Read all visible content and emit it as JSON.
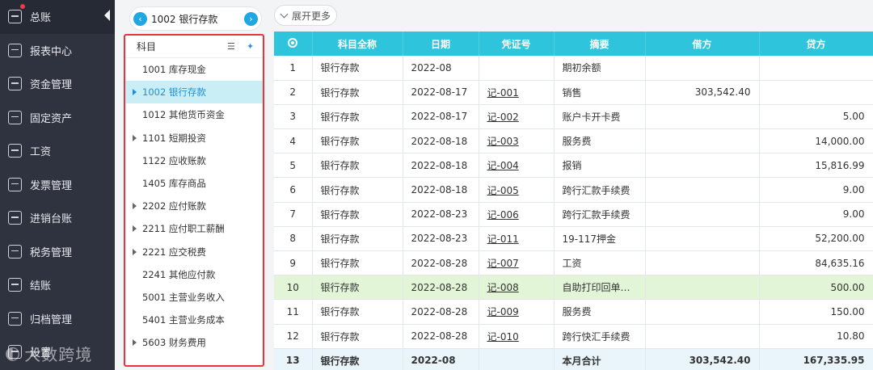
{
  "nav": {
    "items": [
      {
        "label": "总账",
        "icon": "ledger-icon"
      },
      {
        "label": "报表中心",
        "icon": "report-chart-icon"
      },
      {
        "label": "资金管理",
        "icon": "money-bag-icon"
      },
      {
        "label": "固定资产",
        "icon": "building-icon"
      },
      {
        "label": "工资",
        "icon": "salary-icon"
      },
      {
        "label": "发票管理",
        "icon": "invoice-icon"
      },
      {
        "label": "进销台账",
        "icon": "inventory-ledger-icon"
      },
      {
        "label": "税务管理",
        "icon": "tax-icon"
      },
      {
        "label": "结账",
        "icon": "checkout-icon"
      },
      {
        "label": "归档管理",
        "icon": "archive-icon"
      },
      {
        "label": "设置",
        "icon": "settings-icon"
      }
    ],
    "watermark": "大数跨境"
  },
  "account_selector": {
    "prev_icon": "chevron-left-icon",
    "next_icon": "chevron-right-icon",
    "current": "1002 银行存款"
  },
  "subject_tree": {
    "header": "科目",
    "items": [
      {
        "label": "1001 库存现金",
        "expandable": false,
        "selected": false
      },
      {
        "label": "1002 银行存款",
        "expandable": true,
        "selected": true
      },
      {
        "label": "1012 其他货币资金",
        "expandable": false,
        "selected": false
      },
      {
        "label": "1101 短期投资",
        "expandable": true,
        "selected": false
      },
      {
        "label": "1122 应收账款",
        "expandable": false,
        "selected": false
      },
      {
        "label": "1405 库存商品",
        "expandable": false,
        "selected": false
      },
      {
        "label": "2202 应付账款",
        "expandable": true,
        "selected": false
      },
      {
        "label": "2211 应付职工薪酬",
        "expandable": true,
        "selected": false
      },
      {
        "label": "2221 应交税费",
        "expandable": true,
        "selected": false
      },
      {
        "label": "2241 其他应付款",
        "expandable": false,
        "selected": false
      },
      {
        "label": "5001 主营业务收入",
        "expandable": false,
        "selected": false
      },
      {
        "label": "5401 主营业务成本",
        "expandable": false,
        "selected": false
      },
      {
        "label": "5603 财务费用",
        "expandable": true,
        "selected": false
      }
    ]
  },
  "toolbar": {
    "expand_label": "展开更多"
  },
  "ledger": {
    "columns": [
      "科目全称",
      "日期",
      "凭证号",
      "摘要",
      "借方",
      "贷方"
    ],
    "rows": [
      {
        "idx": "1",
        "account": "银行存款",
        "date": "2022-08",
        "voucher": "",
        "summary": "期初余额",
        "debit": "",
        "credit": ""
      },
      {
        "idx": "2",
        "account": "银行存款",
        "date": "2022-08-17",
        "voucher": "记-001",
        "summary": "销售",
        "debit": "303,542.40",
        "credit": ""
      },
      {
        "idx": "3",
        "account": "银行存款",
        "date": "2022-08-17",
        "voucher": "记-002",
        "summary": "账户卡开卡费",
        "debit": "",
        "credit": "5.00"
      },
      {
        "idx": "4",
        "account": "银行存款",
        "date": "2022-08-18",
        "voucher": "记-003",
        "summary": "服务费",
        "debit": "",
        "credit": "14,000.00"
      },
      {
        "idx": "5",
        "account": "银行存款",
        "date": "2022-08-18",
        "voucher": "记-004",
        "summary": "报销",
        "debit": "",
        "credit": "15,816.99"
      },
      {
        "idx": "6",
        "account": "银行存款",
        "date": "2022-08-18",
        "voucher": "记-005",
        "summary": "跨行汇款手续费",
        "debit": "",
        "credit": "9.00"
      },
      {
        "idx": "7",
        "account": "银行存款",
        "date": "2022-08-23",
        "voucher": "记-006",
        "summary": "跨行汇款手续费",
        "debit": "",
        "credit": "9.00"
      },
      {
        "idx": "8",
        "account": "银行存款",
        "date": "2022-08-23",
        "voucher": "记-011",
        "summary": "19-117押金",
        "debit": "",
        "credit": "52,200.00"
      },
      {
        "idx": "9",
        "account": "银行存款",
        "date": "2022-08-28",
        "voucher": "记-007",
        "summary": "工资",
        "debit": "",
        "credit": "84,635.16"
      },
      {
        "idx": "10",
        "account": "银行存款",
        "date": "2022-08-28",
        "voucher": "记-008",
        "summary": "自助打印回单手...",
        "debit": "",
        "credit": "500.00",
        "highlight": true
      },
      {
        "idx": "11",
        "account": "银行存款",
        "date": "2022-08-28",
        "voucher": "记-009",
        "summary": "服务费",
        "debit": "",
        "credit": "150.00"
      },
      {
        "idx": "12",
        "account": "银行存款",
        "date": "2022-08-28",
        "voucher": "记-010",
        "summary": "跨行快汇手续费",
        "debit": "",
        "credit": "10.80"
      },
      {
        "idx": "13",
        "account": "银行存款",
        "date": "2022-08",
        "voucher": "",
        "summary": "本月合计",
        "debit": "303,542.40",
        "credit": "167,335.95",
        "total": true
      }
    ]
  },
  "colors": {
    "nav_bg": "#2f3340",
    "header_teal": "#2ec5dc",
    "selected_bg": "#c9eef6",
    "highlight_row": "#e2f5d7",
    "box_border": "#e8353b"
  }
}
